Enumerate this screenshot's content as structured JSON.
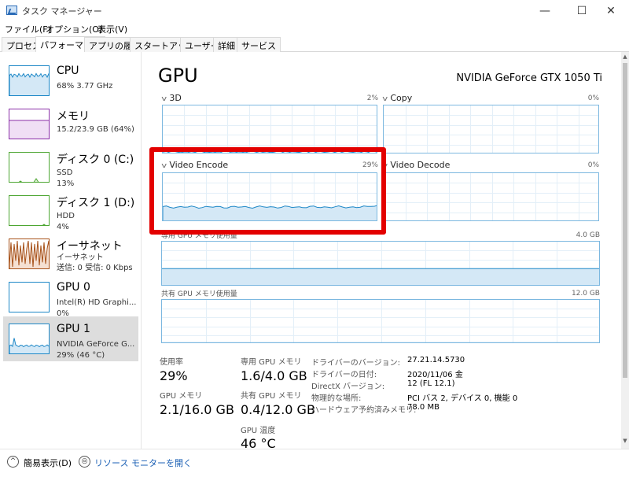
{
  "window": {
    "title": "タスク マネージャー",
    "minimize": "—",
    "maximize": "☐",
    "close": "✕"
  },
  "menu": [
    "ファイル(F)",
    "オプション(O)",
    "表示(V)"
  ],
  "tabs": [
    "プロセス",
    "パフォーマンス",
    "アプリの履歴",
    "スタートアップ",
    "ユーザー",
    "詳細",
    "サービス"
  ],
  "sidebar": [
    {
      "title": "CPU",
      "line1": "68%  3.77 GHz",
      "line2": ""
    },
    {
      "title": "メモリ",
      "line1": "15.2/23.9 GB (64%)",
      "line2": ""
    },
    {
      "title": "ディスク 0 (C:)",
      "line1": "SSD",
      "line2": "13%"
    },
    {
      "title": "ディスク 1 (D:)",
      "line1": "HDD",
      "line2": "4%"
    },
    {
      "title": "イーサネット",
      "line1": "イーサネット",
      "line2": "送信: 0  受信: 0 Kbps"
    },
    {
      "title": "GPU 0",
      "line1": "Intel(R) HD Graphi...",
      "line2": "0%"
    },
    {
      "title": "GPU 1",
      "line1": "NVIDIA GeForce G...",
      "line2": "29%  (46 °C)"
    }
  ],
  "main": {
    "title": "GPU",
    "model": "NVIDIA GeForce GTX 1050 Ti",
    "graphs": [
      {
        "label": "3D",
        "pct": "2%",
        "usage": 0.02
      },
      {
        "label": "Copy",
        "pct": "0%",
        "usage": 0.0
      },
      {
        "label": "Video Encode",
        "pct": "29%",
        "usage": 0.29
      },
      {
        "label": "Video Decode",
        "pct": "0%",
        "usage": 0.0
      }
    ],
    "dedicated_mem": {
      "label": "専用 GPU メモリ使用量",
      "max": "4.0 GB",
      "usage": 0.4
    },
    "shared_mem": {
      "label": "共有 GPU メモリ使用量",
      "max": "12.0 GB",
      "usage": 0.03
    },
    "stats": {
      "usage_label": "使用率",
      "usage_value": "29%",
      "gpu_mem_label": "GPU メモリ",
      "gpu_mem_value": "2.1/16.0 GB",
      "ded_label": "専用 GPU メモリ",
      "ded_value": "1.6/4.0 GB",
      "shared_label": "共有 GPU メモリ",
      "shared_value": "0.4/12.0 GB",
      "temp_label": "GPU 温度",
      "temp_value": "46 °C"
    },
    "info": [
      {
        "label": "ドライバーのバージョン:",
        "value": "27.21.14.5730"
      },
      {
        "label": "ドライバーの日付:",
        "value": "2020/11/06 金"
      },
      {
        "label": "DirectX バージョン:",
        "value": "12 (FL 12.1)"
      },
      {
        "label": "物理的な場所:",
        "value": "PCI バス 2, デバイス 0, 機能 0"
      },
      {
        "label": "ハードウェア予約済みメモリ:",
        "value": "78.0 MB"
      }
    ]
  },
  "bottom": {
    "fewer_details": "簡易表示(D)",
    "resource_monitor": "リソース モニターを開く"
  },
  "colors": {
    "cpu": "#1e88c7",
    "memory": "#8b2fa8",
    "disk": "#4da632",
    "ethernet": "#a7521a",
    "gpu": "#1e88c7",
    "highlight": "#e30000"
  }
}
